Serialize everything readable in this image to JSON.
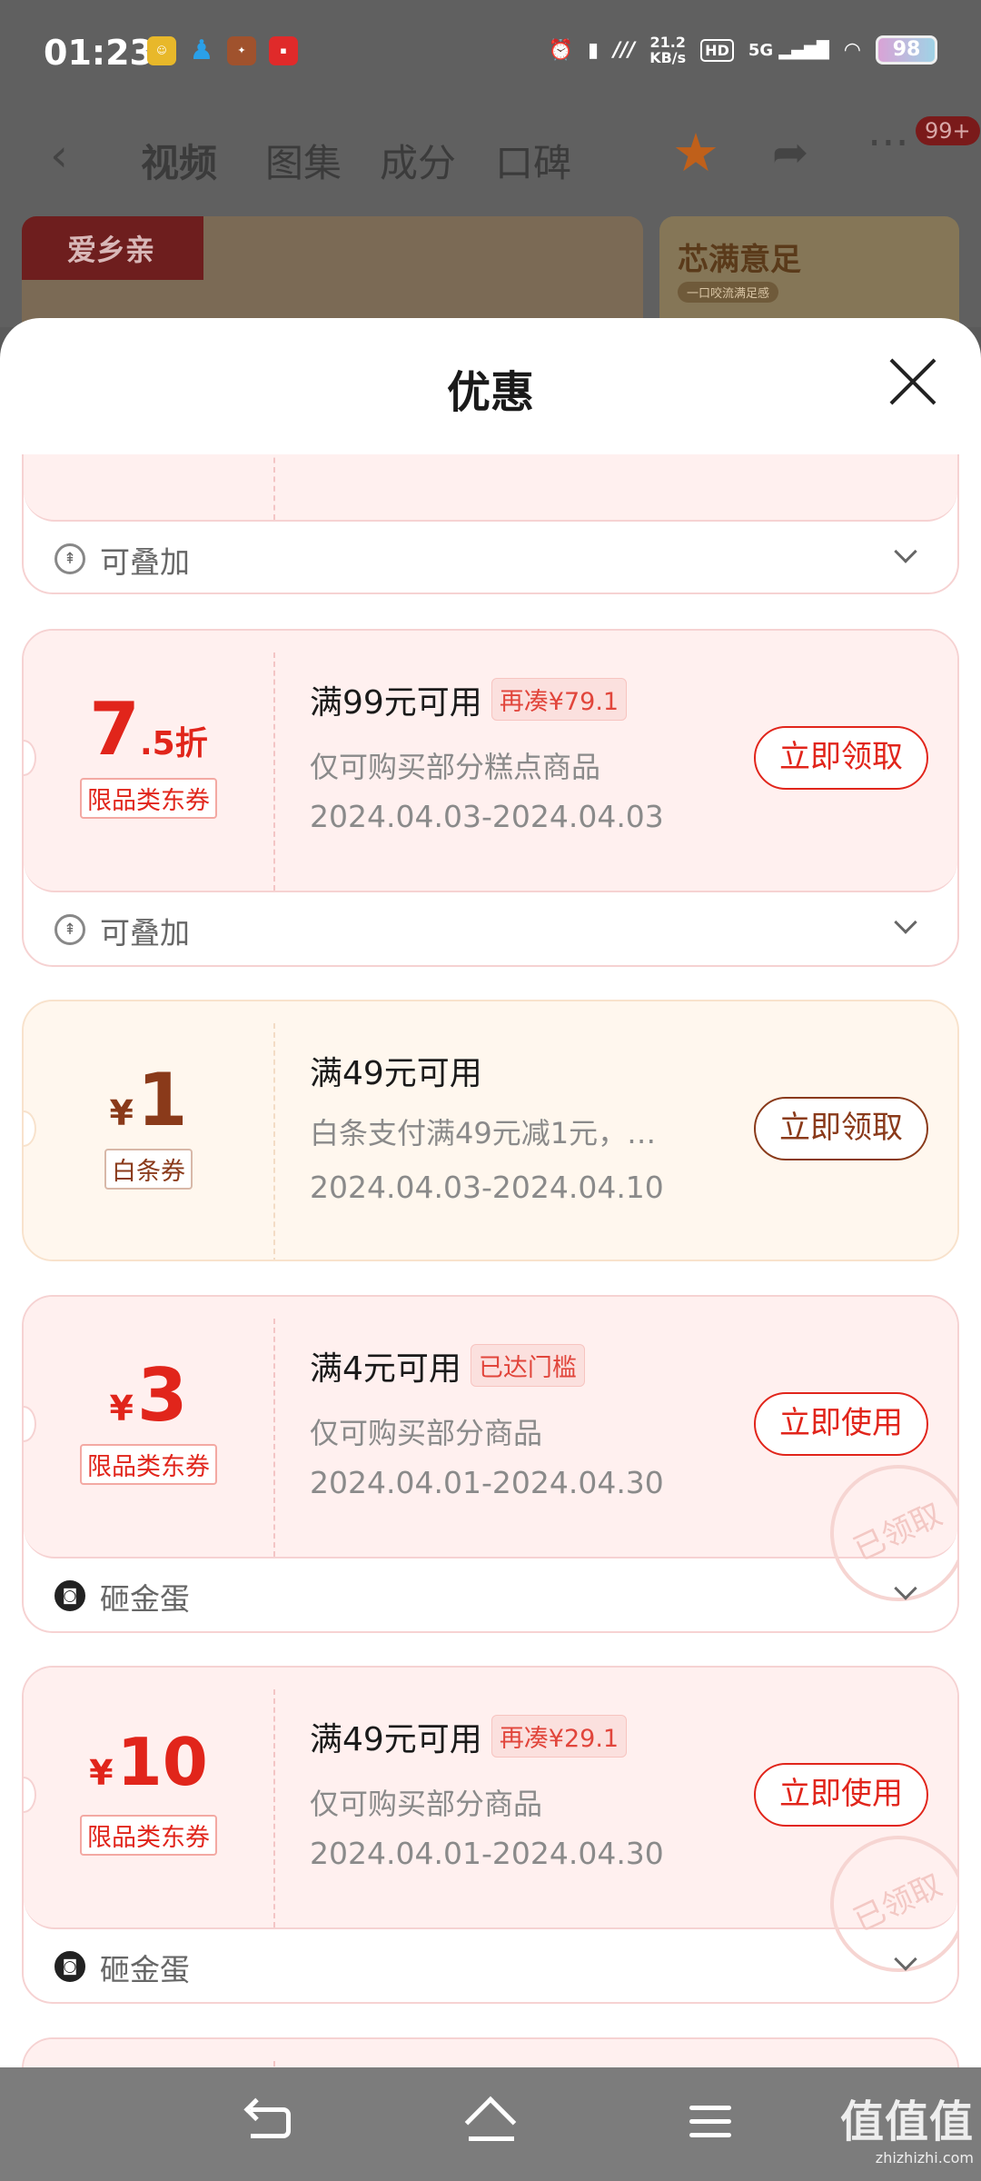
{
  "status_bar": {
    "time": "01:23",
    "net_speed_value": "21.2",
    "net_speed_unit": "KB/s",
    "hd": "HD",
    "network": "5G",
    "battery": "98"
  },
  "top_nav": {
    "tabs": [
      "视频",
      "图集",
      "成分",
      "口碑"
    ],
    "more_badge": "99+"
  },
  "banners": {
    "left_brand": "爱乡亲",
    "right_title": "芯满意足",
    "right_sub": "一口咬流满足感"
  },
  "sheet": {
    "title": "优惠"
  },
  "coupons": [
    {
      "extra_label": "可叠加"
    },
    {
      "amount_main": "7",
      "amount_suffix": ".5折",
      "type": "限品类东券",
      "condition": "满99元可用",
      "tag": "再凑¥79.1",
      "desc": "仅可购买部分糕点商品",
      "date": "2024.04.03-2024.04.03",
      "button": "立即领取",
      "extra_label": "可叠加"
    },
    {
      "currency": "¥",
      "amount_main": "1",
      "type": "白条券",
      "condition": "满49元可用",
      "desc": "白条支付满49元减1元，…",
      "date": "2024.04.03-2024.04.10",
      "button": "立即领取"
    },
    {
      "currency": "¥",
      "amount_main": "3",
      "type": "限品类东券",
      "condition": "满4元可用",
      "tag": "已达门槛",
      "desc": "仅可购买部分商品",
      "date": "2024.04.01-2024.04.30",
      "button": "立即使用",
      "stamp": "已领取",
      "extra_label": "砸金蛋"
    },
    {
      "currency": "¥",
      "amount_main": "10",
      "type": "限品类东券",
      "condition": "满49元可用",
      "tag": "再凑¥29.1",
      "desc": "仅可购买部分商品",
      "date": "2024.04.01-2024.04.30",
      "button": "立即使用",
      "stamp": "已领取",
      "extra_label": "砸金蛋"
    }
  ],
  "watermark": {
    "main": "值值值",
    "sub": "zhizhizhi.com"
  }
}
